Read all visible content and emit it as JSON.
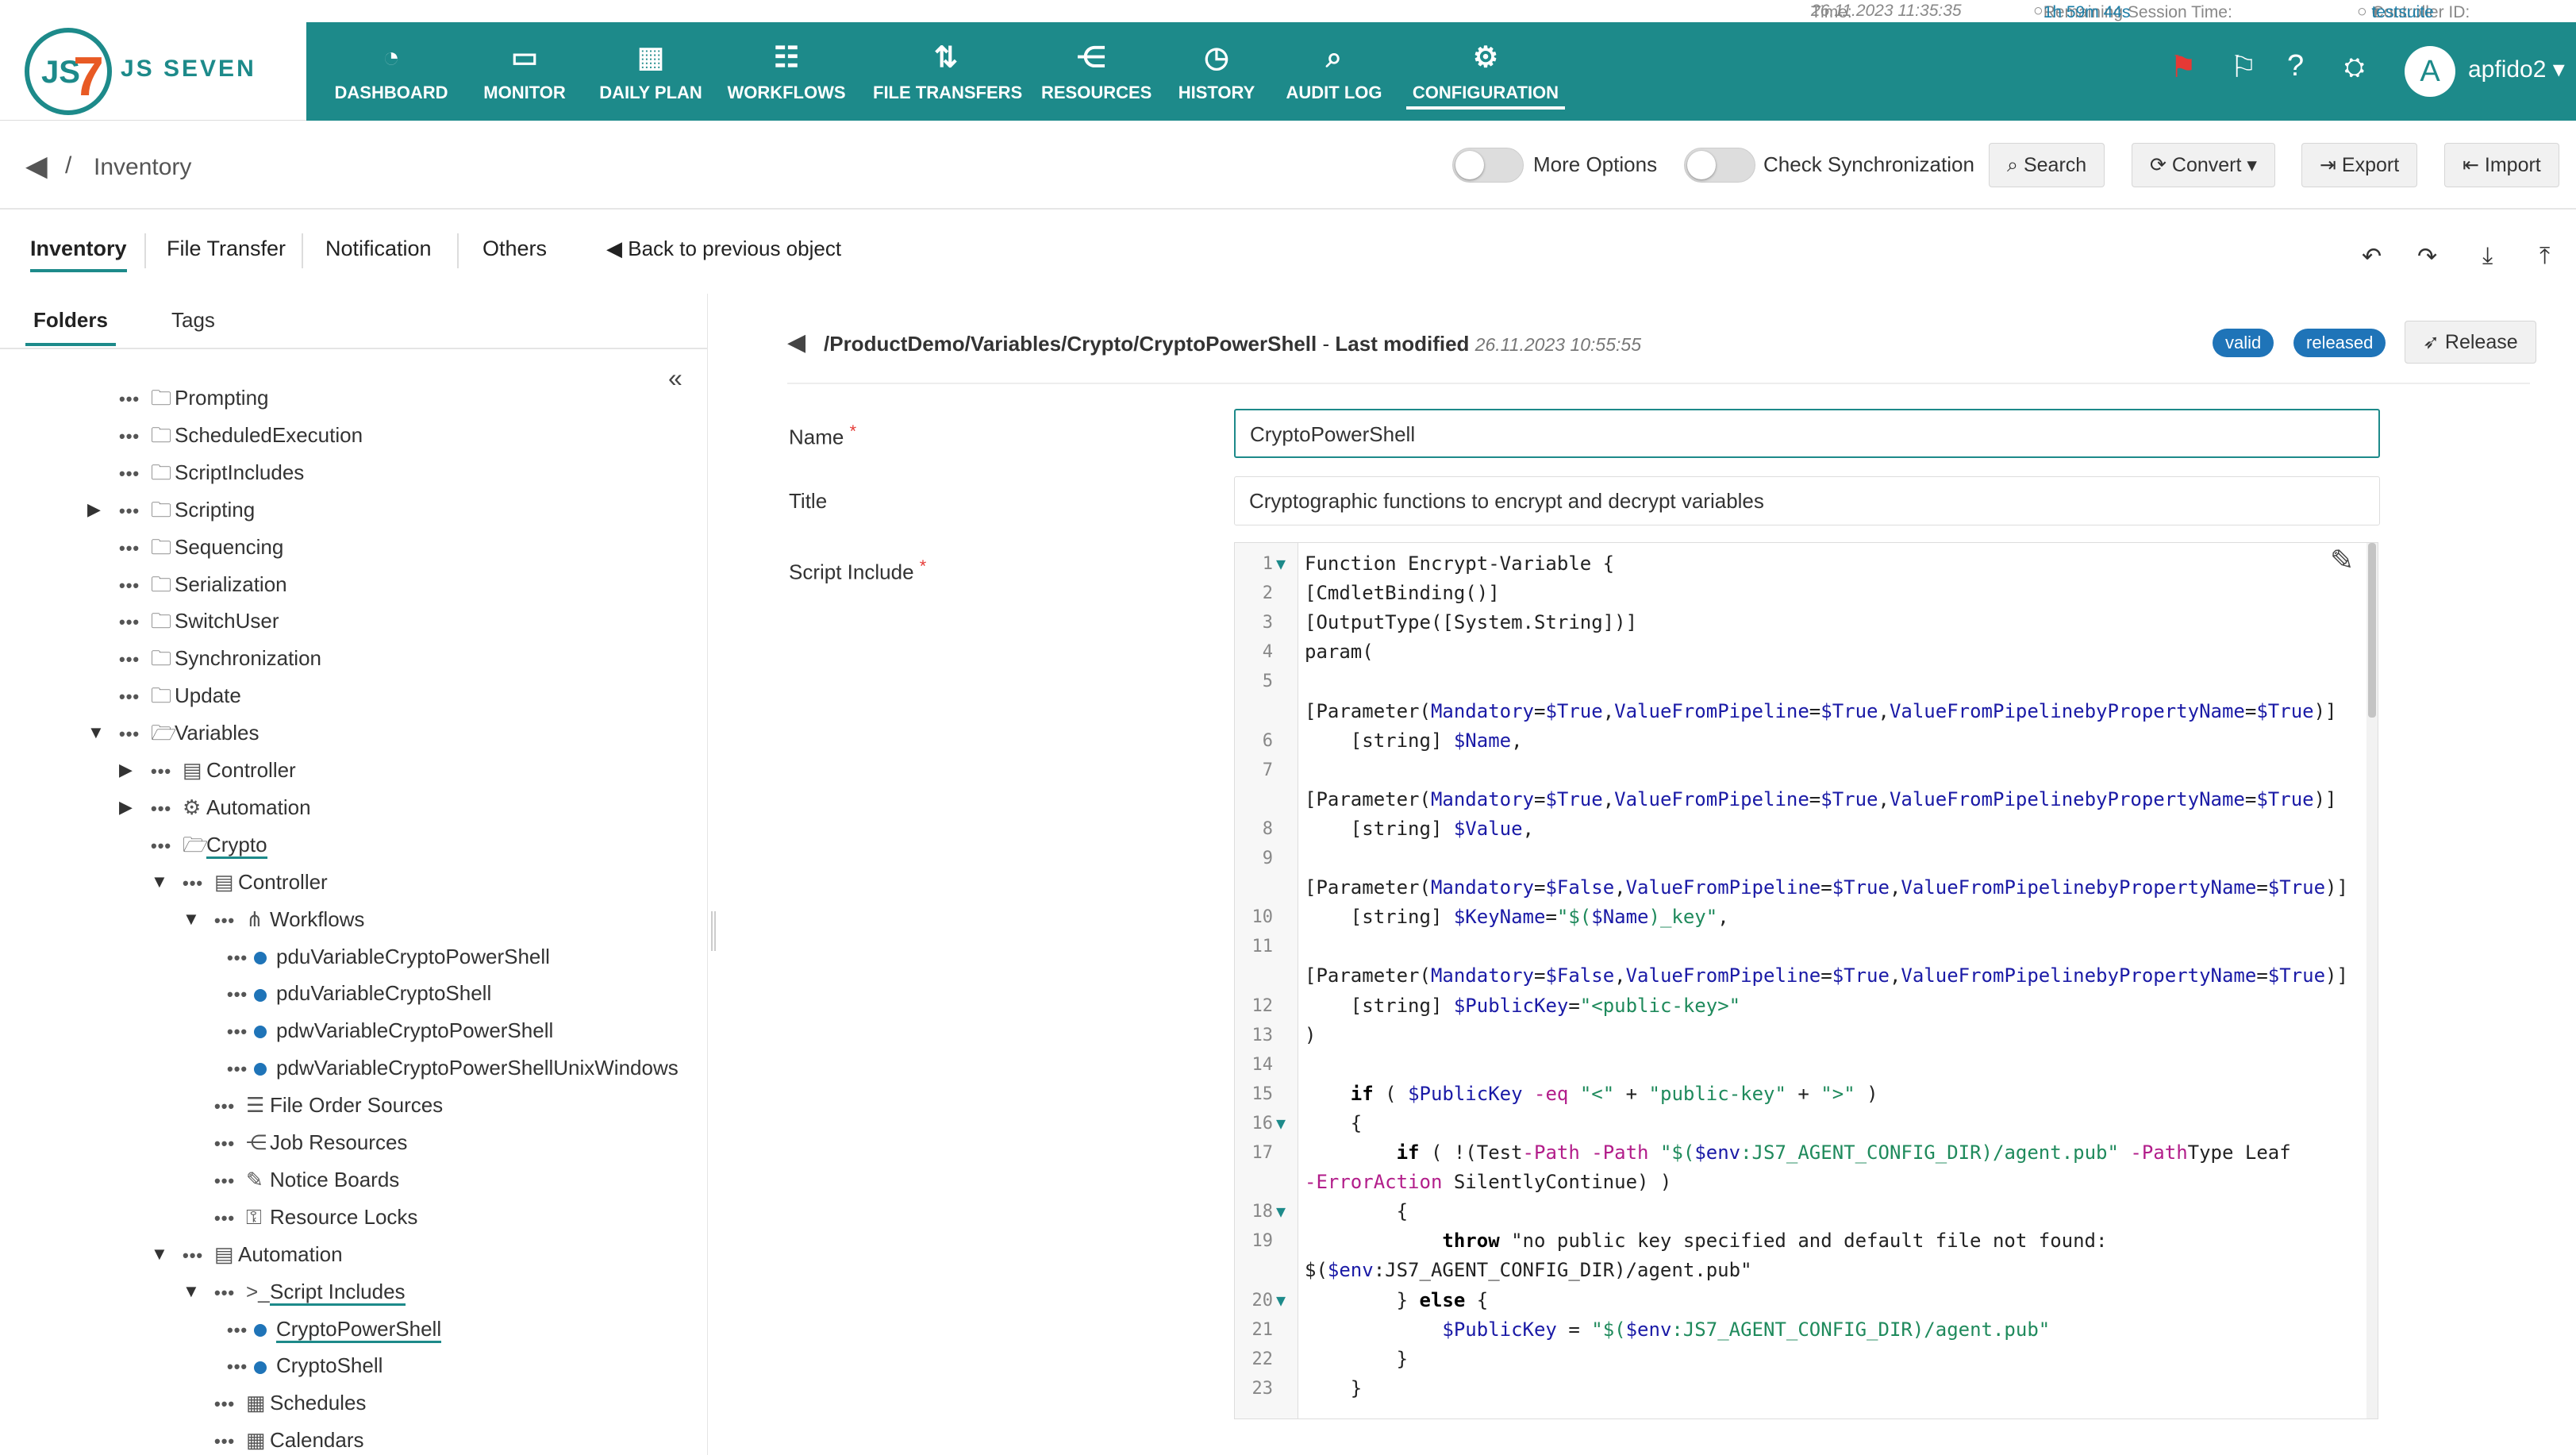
{
  "status": {
    "time_label": "Time:",
    "time": "26.11.2023 11:35:35",
    "remaining_label": "Remaining Session Time:",
    "remaining": "1h 59m 44s",
    "controller_label": "Controller ID:",
    "controller": "testsuite"
  },
  "logo": {
    "text": "JS SEVEN"
  },
  "nav": [
    {
      "label": "DASHBOARD",
      "icon": "dashboard-icon"
    },
    {
      "label": "MONITOR",
      "icon": "monitor-icon"
    },
    {
      "label": "DAILY PLAN",
      "icon": "calendar-icon"
    },
    {
      "label": "WORKFLOWS",
      "icon": "workflow-icon"
    },
    {
      "label": "FILE TRANSFERS",
      "icon": "transfer-icon"
    },
    {
      "label": "RESOURCES",
      "icon": "share-icon"
    },
    {
      "label": "HISTORY",
      "icon": "clock-icon"
    },
    {
      "label": "AUDIT LOG",
      "icon": "audit-icon"
    },
    {
      "label": "CONFIGURATION",
      "icon": "gear-icon"
    }
  ],
  "user": {
    "avatar": "A",
    "name": "apfido2"
  },
  "breadcrumb": {
    "sep": "/",
    "title": "Inventory"
  },
  "toolbar": {
    "more_options": "More Options",
    "check_sync": "Check Synchronization",
    "search": "Search",
    "convert": "Convert",
    "export": "Export",
    "import": "Import"
  },
  "tabs": {
    "inventory": "Inventory",
    "file_transfer": "File Transfer",
    "notification": "Notification",
    "others": "Others",
    "back": "Back to previous object"
  },
  "subtabs": {
    "folders": "Folders",
    "tags": "Tags"
  },
  "tree": [
    {
      "label": "Prompting",
      "kind": "folder",
      "indent": 0,
      "caret": ""
    },
    {
      "label": "ScheduledExecution",
      "kind": "folder",
      "indent": 0,
      "caret": ""
    },
    {
      "label": "ScriptIncludes",
      "kind": "folder",
      "indent": 0,
      "caret": ""
    },
    {
      "label": "Scripting",
      "kind": "folder",
      "indent": 0,
      "caret": "right"
    },
    {
      "label": "Sequencing",
      "kind": "folder",
      "indent": 0,
      "caret": ""
    },
    {
      "label": "Serialization",
      "kind": "folder",
      "indent": 0,
      "caret": ""
    },
    {
      "label": "SwitchUser",
      "kind": "folder",
      "indent": 0,
      "caret": ""
    },
    {
      "label": "Synchronization",
      "kind": "folder",
      "indent": 0,
      "caret": ""
    },
    {
      "label": "Update",
      "kind": "folder",
      "indent": 0,
      "caret": ""
    },
    {
      "label": "Variables",
      "kind": "folder-open",
      "indent": 0,
      "caret": "down"
    },
    {
      "label": "Controller",
      "kind": "doc",
      "indent": 1,
      "caret": "right"
    },
    {
      "label": "Automation",
      "kind": "auto",
      "indent": 1,
      "caret": "right"
    },
    {
      "label": "Crypto",
      "kind": "folder-open",
      "indent": 1,
      "caret": "",
      "ul": true
    },
    {
      "label": "Controller",
      "kind": "doc",
      "indent": 2,
      "caret": "down"
    },
    {
      "label": "Workflows",
      "kind": "wf",
      "indent": 3,
      "caret": "down"
    },
    {
      "label": "pduVariableCryptoPowerShell",
      "kind": "dot",
      "indent": 4,
      "caret": ""
    },
    {
      "label": "pduVariableCryptoShell",
      "kind": "dot",
      "indent": 4,
      "caret": ""
    },
    {
      "label": "pdwVariableCryptoPowerShell",
      "kind": "dot",
      "indent": 4,
      "caret": ""
    },
    {
      "label": "pdwVariableCryptoPowerShellUnixWindows",
      "kind": "dot",
      "indent": 4,
      "caret": ""
    },
    {
      "label": "File Order Sources",
      "kind": "list",
      "indent": 3,
      "caret": ""
    },
    {
      "label": "Job Resources",
      "kind": "share",
      "indent": 3,
      "caret": ""
    },
    {
      "label": "Notice Boards",
      "kind": "pin",
      "indent": 3,
      "caret": ""
    },
    {
      "label": "Resource Locks",
      "kind": "lock",
      "indent": 3,
      "caret": ""
    },
    {
      "label": "Automation",
      "kind": "doc",
      "indent": 2,
      "caret": "down"
    },
    {
      "label": "Script Includes",
      "kind": "term",
      "indent": 3,
      "caret": "down",
      "ul": true
    },
    {
      "label": "CryptoPowerShell",
      "kind": "dot",
      "indent": 4,
      "caret": "",
      "ul": true
    },
    {
      "label": "CryptoShell",
      "kind": "dot",
      "indent": 4,
      "caret": ""
    },
    {
      "label": "Schedules",
      "kind": "sched",
      "indent": 3,
      "caret": ""
    },
    {
      "label": "Calendars",
      "kind": "cal",
      "indent": 3,
      "caret": ""
    }
  ],
  "detail": {
    "path": "/ProductDemo/Variables/Crypto/CryptoPowerShell",
    "dash": "-",
    "modified_label": "Last modified",
    "modified": "26.11.2023 10:55:55",
    "badge_valid": "valid",
    "badge_released": "released",
    "release": "Release"
  },
  "form": {
    "name_label": "Name",
    "name_value": "CryptoPowerShell",
    "title_label": "Title",
    "title_value": "Cryptographic functions to encrypt and decrypt variables",
    "script_label": "Script Include",
    "req": "*"
  },
  "code": [
    {
      "n": "1",
      "t": "Function Encrypt-Variable {",
      "fold": true
    },
    {
      "n": "2",
      "t": "[CmdletBinding()]"
    },
    {
      "n": "3",
      "t": "[OutputType([System.String])]"
    },
    {
      "n": "4",
      "t": "param("
    },
    {
      "n": "5",
      "t": ""
    },
    {
      "n": "",
      "t": "[Parameter(Mandatory=$True,ValueFromPipeline=$True,ValueFromPipelinebyPropertyName=$True)]"
    },
    {
      "n": "6",
      "t": "    [string] $Name,"
    },
    {
      "n": "7",
      "t": ""
    },
    {
      "n": "",
      "t": "[Parameter(Mandatory=$True,ValueFromPipeline=$True,ValueFromPipelinebyPropertyName=$True)]"
    },
    {
      "n": "8",
      "t": "    [string] $Value,"
    },
    {
      "n": "9",
      "t": ""
    },
    {
      "n": "",
      "t": "[Parameter(Mandatory=$False,ValueFromPipeline=$True,ValueFromPipelinebyPropertyName=$True)]"
    },
    {
      "n": "10",
      "t": "    [string] $KeyName=\"$($Name)_key\","
    },
    {
      "n": "11",
      "t": ""
    },
    {
      "n": "",
      "t": "[Parameter(Mandatory=$False,ValueFromPipeline=$True,ValueFromPipelinebyPropertyName=$True)]"
    },
    {
      "n": "12",
      "t": "    [string] $PublicKey=\"<public-key>\""
    },
    {
      "n": "13",
      "t": ")"
    },
    {
      "n": "14",
      "t": ""
    },
    {
      "n": "15",
      "t": "    if ( $PublicKey -eq \"<\" + \"public-key\" + \">\" )"
    },
    {
      "n": "16",
      "t": "    {",
      "fold": true
    },
    {
      "n": "17",
      "t": "        if ( !(Test-Path -Path \"$($env:JS7_AGENT_CONFIG_DIR)/agent.pub\" -PathType Leaf"
    },
    {
      "n": "",
      "t": "-ErrorAction SilentlyContinue) )"
    },
    {
      "n": "18",
      "t": "        {",
      "fold": true
    },
    {
      "n": "19",
      "t": "            throw \"no public key specified and default file not found:"
    },
    {
      "n": "",
      "t": "$($env:JS7_AGENT_CONFIG_DIR)/agent.pub\""
    },
    {
      "n": "20",
      "t": "        } else {",
      "fold": true
    },
    {
      "n": "21",
      "t": "            $PublicKey = \"$($env:JS7_AGENT_CONFIG_DIR)/agent.pub\""
    },
    {
      "n": "22",
      "t": "        }"
    },
    {
      "n": "23",
      "t": "    }"
    }
  ]
}
